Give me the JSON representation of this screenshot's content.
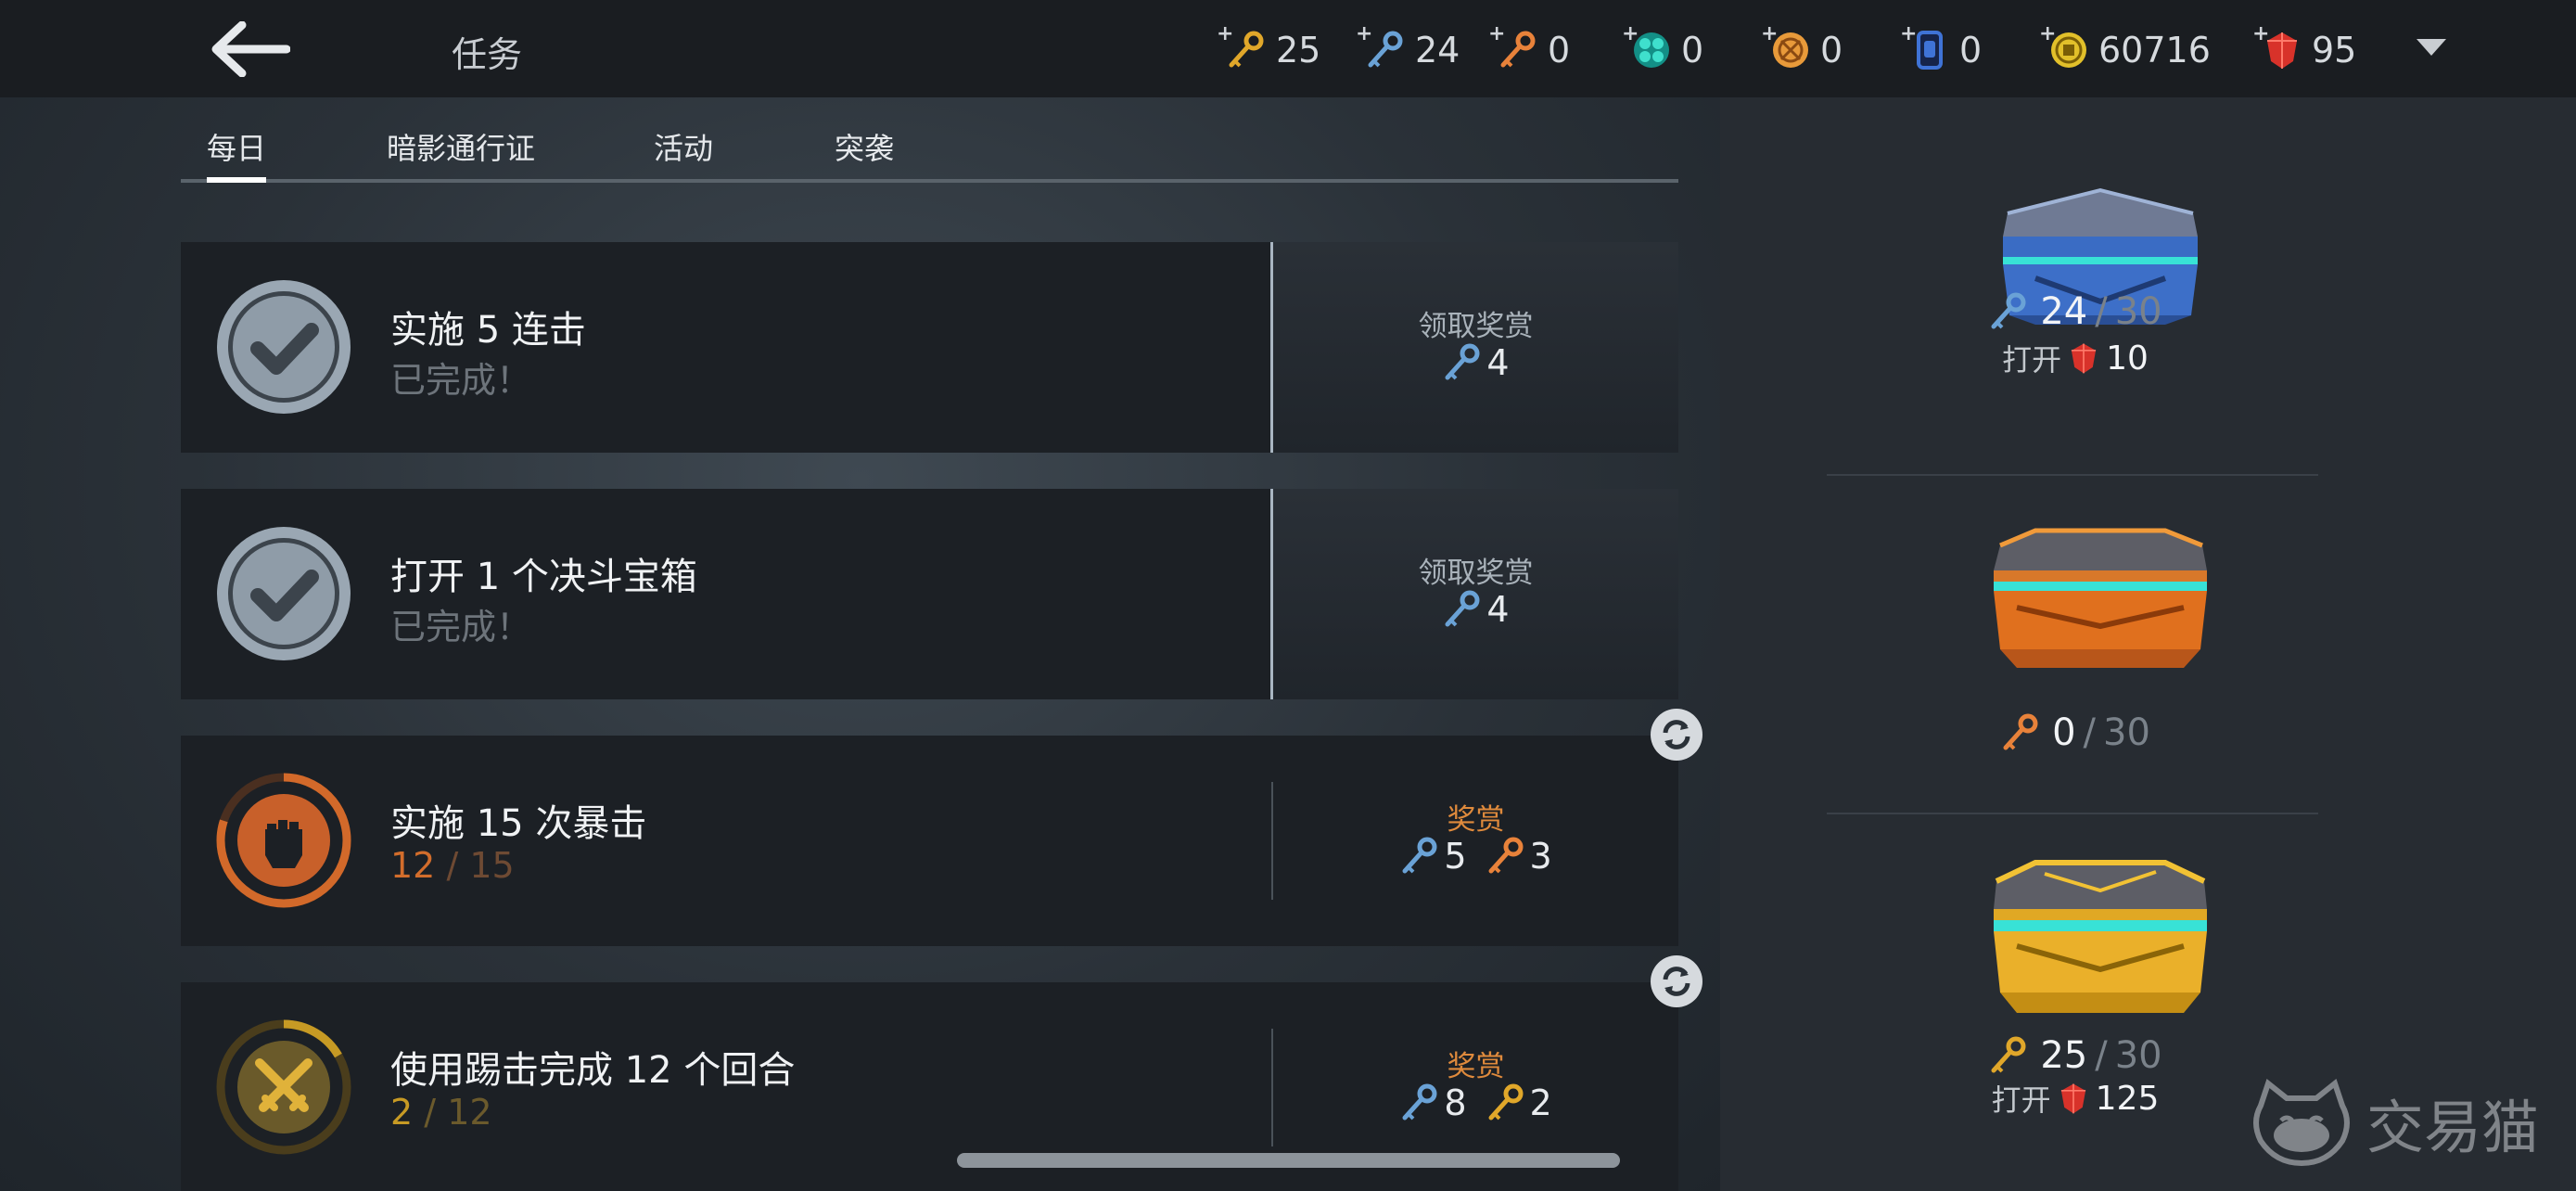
{
  "header": {
    "title": "任务",
    "currencies": [
      {
        "icon": "gold-key-icon",
        "value": "25",
        "color": "#e0a72a"
      },
      {
        "icon": "blue-key-icon",
        "value": "24",
        "color": "#6aa2d6"
      },
      {
        "icon": "orange-key-icon",
        "value": "0",
        "color": "#e8823a"
      },
      {
        "icon": "teal-gem-icon",
        "value": "0",
        "color": "#1fb7a6"
      },
      {
        "icon": "orange-orb-icon",
        "value": "0",
        "color": "#e89a3a"
      },
      {
        "icon": "blue-card-icon",
        "value": "0",
        "color": "#3f73d6"
      },
      {
        "icon": "gold-coin-icon",
        "value": "60716",
        "color": "#e2c02a"
      },
      {
        "icon": "ruby-icon",
        "value": "95",
        "color": "#d8322a"
      }
    ]
  },
  "tabs": [
    {
      "label": "每日",
      "active": true
    },
    {
      "label": "暗影通行证",
      "active": false
    },
    {
      "label": "活动",
      "active": false
    },
    {
      "label": "突袭",
      "active": false
    }
  ],
  "tasks": [
    {
      "name": "实施 5 连击",
      "status": "已完成！",
      "state": "done",
      "reward_label": "领取奖赏",
      "rewards": [
        {
          "icon": "blue-key-icon",
          "amount": "4"
        }
      ]
    },
    {
      "name": "打开 1 个决斗宝箱",
      "status": "已完成！",
      "state": "done",
      "reward_label": "领取奖赏",
      "rewards": [
        {
          "icon": "blue-key-icon",
          "amount": "4"
        }
      ]
    },
    {
      "name": "实施 15 次暴击",
      "progress_current": "12",
      "progress_sep": "/",
      "progress_total": "15",
      "progress_fraction": 0.8,
      "state": "active",
      "reward_label": "奖赏",
      "rewards": [
        {
          "icon": "blue-key-icon",
          "amount": "5"
        },
        {
          "icon": "orange-key-icon",
          "amount": "3"
        }
      ]
    },
    {
      "name": "使用踢击完成 12 个回合",
      "progress_current": "2",
      "progress_sep": "/",
      "progress_total": "12",
      "progress_fraction": 0.1667,
      "state": "active",
      "reward_label": "奖赏",
      "rewards": [
        {
          "icon": "blue-key-icon",
          "amount": "8"
        },
        {
          "icon": "gold-key-icon",
          "amount": "2"
        }
      ]
    }
  ],
  "chests": [
    {
      "name": "blue-chest",
      "key_icon": "blue-key-icon",
      "count": "24",
      "sep": "/",
      "total": "30",
      "open_label": "打开",
      "open_cost": "10"
    },
    {
      "name": "orange-chest",
      "key_icon": "orange-key-icon",
      "count": "0",
      "sep": "/",
      "total": "30"
    },
    {
      "name": "gold-chest",
      "key_icon": "gold-key-icon",
      "count": "25",
      "sep": "/",
      "total": "30",
      "open_label": "打开",
      "open_cost": "125"
    }
  ],
  "watermark": "交易猫"
}
